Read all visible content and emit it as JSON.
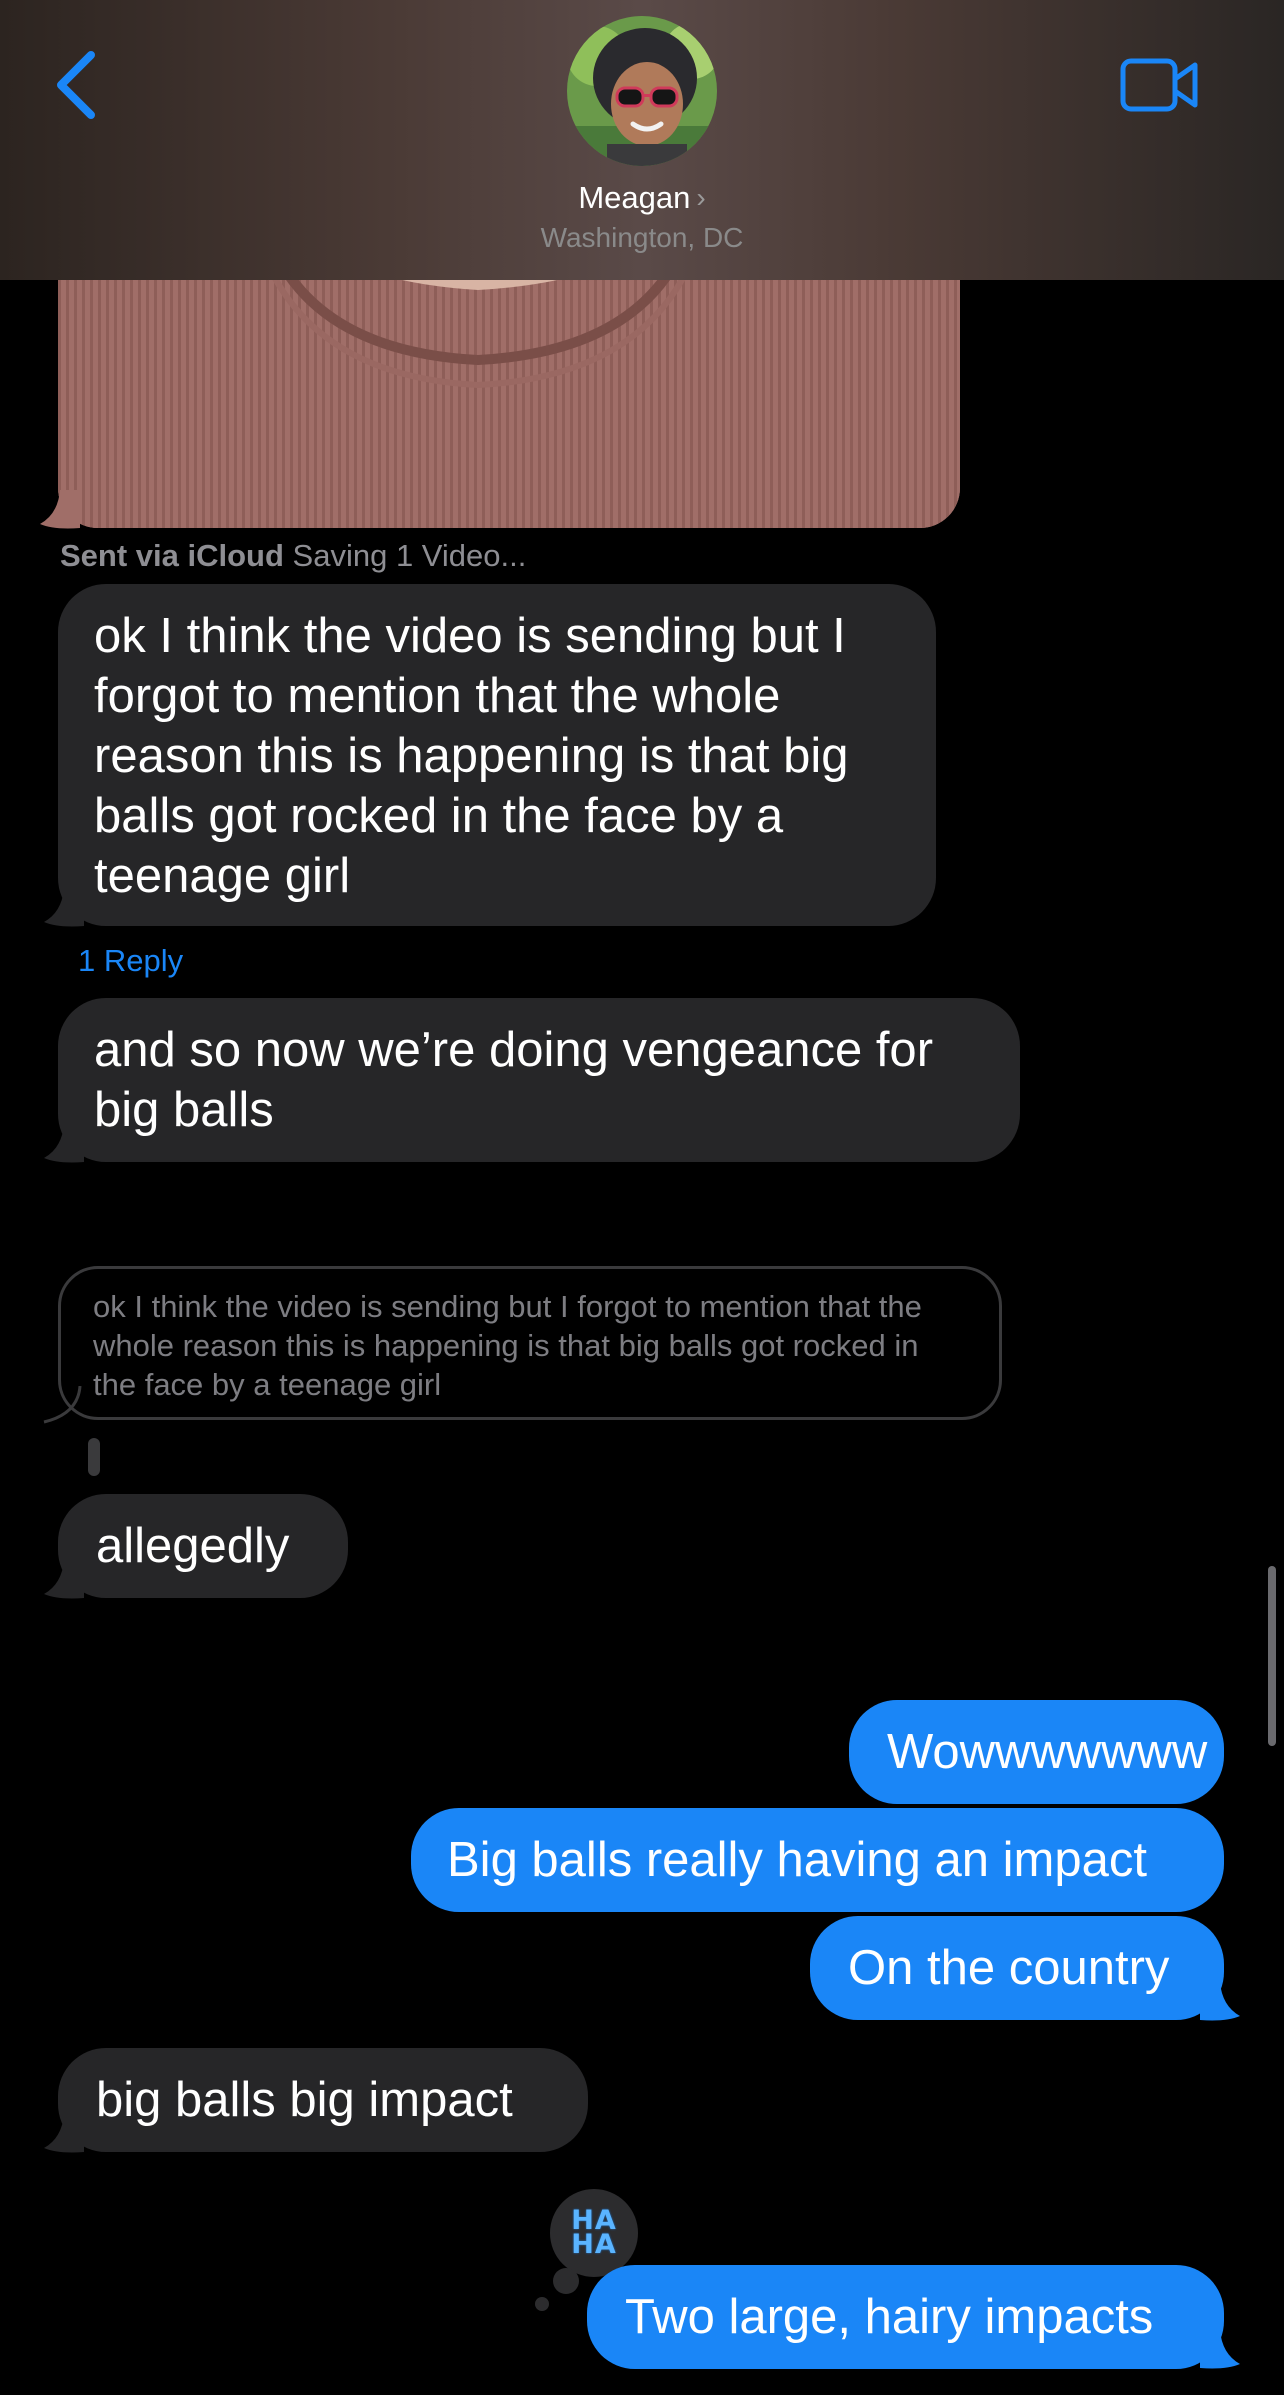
{
  "header": {
    "contact_name": "Meagan",
    "contact_chevron": "›",
    "contact_location": "Washington, DC",
    "back_icon": "chevron-left-icon",
    "video_icon": "video-camera-icon",
    "accent_color": "#1a86f7"
  },
  "attachment": {
    "sent_via": "Sent via iCloud",
    "status": "Saving 1 Video..."
  },
  "messages": [
    {
      "direction": "incoming",
      "text": "ok I think the video is sending but I forgot to mention that the whole reason this is happening is that big balls got rocked in the face by a teenage girl"
    },
    {
      "direction": "incoming",
      "text": "and so now we’re doing vengeance for big balls"
    },
    {
      "direction": "incoming",
      "text": "allegedly"
    },
    {
      "direction": "outgoing",
      "text": "Wowwwwwww"
    },
    {
      "direction": "outgoing",
      "text": "Big balls really having an impact"
    },
    {
      "direction": "outgoing",
      "text": "On the country"
    },
    {
      "direction": "incoming",
      "text": "big balls big impact"
    },
    {
      "direction": "outgoing",
      "text": "Two large, hairy impacts"
    }
  ],
  "reply_count": "1 Reply",
  "quoted_message": "ok I think the video is sending but I forgot to mention that the whole reason this is happening is that big balls got rocked in the face by a teenage girl",
  "tapback": {
    "label": "HA HA",
    "line1": "HA",
    "line2": "HA"
  },
  "colors": {
    "incoming_bubble": "#262628",
    "outgoing_bubble": "#1a86f7",
    "background": "#000000"
  }
}
